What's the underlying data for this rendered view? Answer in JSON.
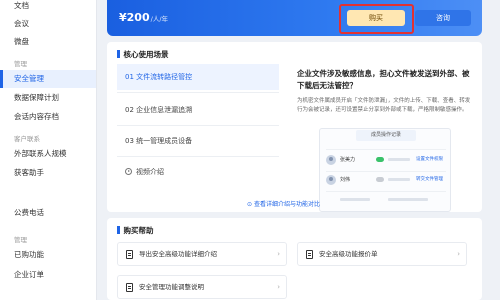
{
  "sidebar": {
    "items": [
      {
        "label": "文档",
        "y": 0
      },
      {
        "label": "会议",
        "y": 0
      },
      {
        "label": "微盘",
        "y": 0
      }
    ],
    "groups": [
      {
        "label": "管理"
      },
      {
        "label": "客户联系"
      },
      {
        "label": "管理"
      }
    ],
    "admin_items": [
      {
        "label": "安全管理"
      },
      {
        "label": "数据保障计划"
      },
      {
        "label": "会话内容存档"
      }
    ],
    "customer_items": [
      {
        "label": "外部联系人规模"
      },
      {
        "label": "获客助手"
      },
      {
        "label": "公费电话"
      }
    ],
    "mgmt_items": [
      {
        "label": "已购功能"
      },
      {
        "label": "企业订单"
      }
    ]
  },
  "banner": {
    "price": "¥200",
    "price_unit": "/人/年",
    "buy_label": "购买",
    "consult_label": "咨询"
  },
  "core": {
    "title": "核心使用场景",
    "scenarios": [
      "01  文件流转路径管控",
      "02  企业信息泄漏追溯",
      "03  统一管理成员设备"
    ],
    "video_label": "视频介绍",
    "detail_title": "企业文件涉及敏感信息，担心文件被发送到外部、被下载后无法管控？",
    "detail_desc": "为机密文件属成员开启「文件防泄漏」，文件的上传、下载、查看、转发行为会被记录，还可设置禁止分享到外部或下载，严格限制敏感操作。",
    "illustration": {
      "title": "成员操作记录",
      "rows": [
        {
          "name": "张美力",
          "link": "设置文件权限"
        },
        {
          "name": "刘伟",
          "link": "转交文件管理"
        }
      ]
    },
    "view_more": "查看详细介绍与功能对比"
  },
  "help": {
    "title": "购买帮助",
    "items": [
      "导出安全高级功能详细介绍",
      "安全高级功能报价单",
      "安全管理功能调整说明"
    ]
  },
  "colors": {
    "accent": "#1f64e6",
    "buy_button": "#ffe7b2",
    "highlight": "#e33131"
  }
}
